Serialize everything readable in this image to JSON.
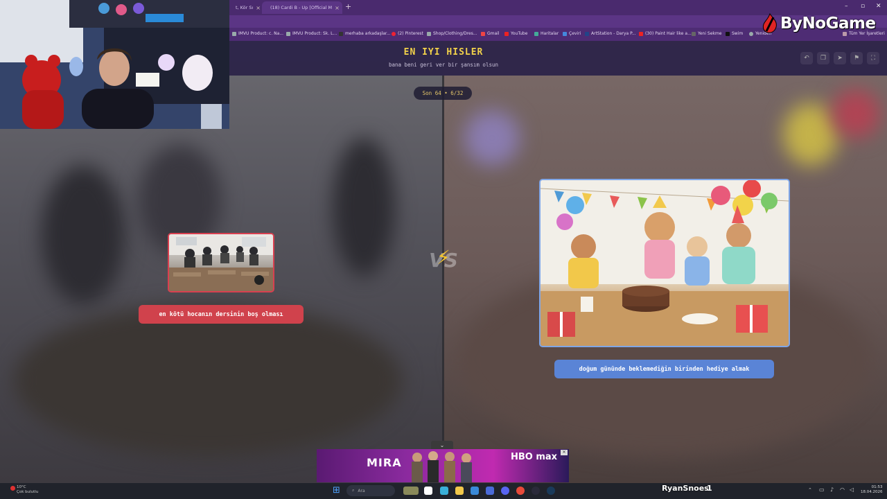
{
  "browser": {
    "tabs": [
      {
        "label": "t, Kör Sı"
      },
      {
        "label": "(18) Cardi B - Up [Official M"
      }
    ],
    "bookmarks": [
      "IMVU Product: c. Na...",
      "IMVU Product: Sk. L...",
      "merhaba arkadaşlar...",
      "(2) Pinterest",
      "Shop/Clothing/Dres...",
      "Gmail",
      "YouTube",
      "Haritalar",
      "Çeviri",
      "ArtStation - Darya P...",
      "(30) Paint Hair like a...",
      "Yeni Sekme",
      "Swim",
      "Yeniden",
      "Tüm Yer İşaretleri"
    ]
  },
  "overlay": {
    "logo_text": "ByNoGame"
  },
  "game": {
    "title": "EN IYI HISLER",
    "subtitle": "bana beni geri ver bir şansım olsun",
    "round": "Son 64 • 6/32",
    "vs": "VS",
    "left": {
      "label": "en kötü hocanın dersinin boş olması",
      "accent": "#d0424c"
    },
    "right": {
      "label": "doğum gününde beklemediğin birinden hediye almak",
      "accent": "#5a84d6"
    },
    "header_icons": [
      "undo-icon",
      "copy-icon",
      "share-icon",
      "flag-icon",
      "fullscreen-icon"
    ]
  },
  "ad": {
    "title": "MIRA",
    "brand": "HBO max"
  },
  "taskbar": {
    "weather_temp": "10°C",
    "weather_desc": "Çok bulutlu",
    "search_placeholder": "Ara",
    "stream_user": "RyanSnoes",
    "stream_count": "1",
    "time": "01:53",
    "date": "18.04.2026"
  }
}
